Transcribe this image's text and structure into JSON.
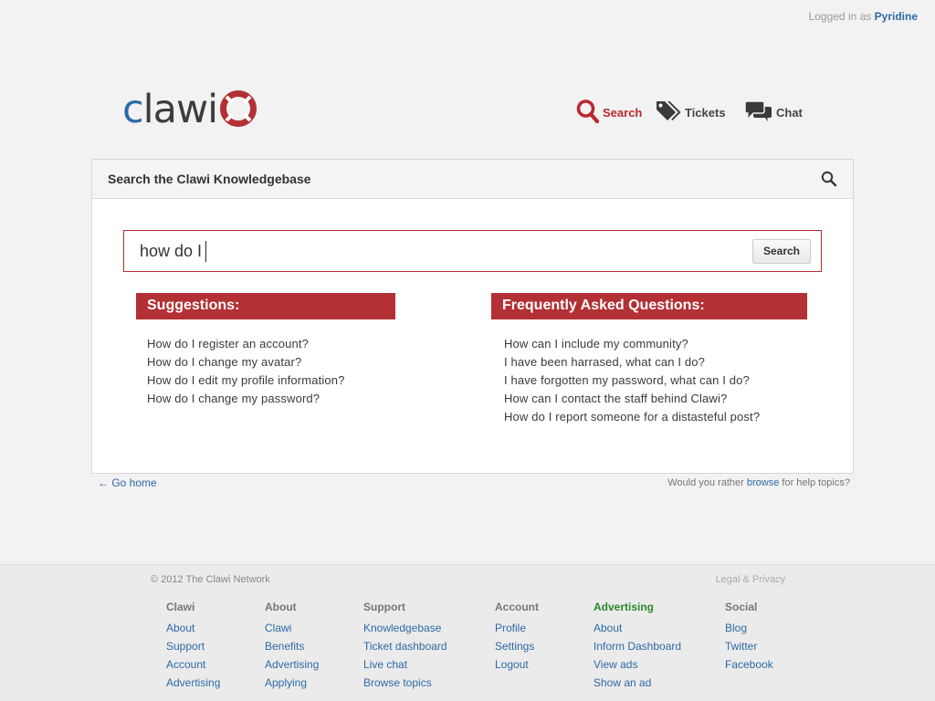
{
  "topbar": {
    "prefix": "Logged in as",
    "username": "Pyridine"
  },
  "logo": {
    "c": "c",
    "rest": "lawi"
  },
  "nav": {
    "search": "Search",
    "tickets": "Tickets",
    "chat": "Chat"
  },
  "panel": {
    "title": "Search the Clawi Knowledgebase"
  },
  "search": {
    "value": "how do I",
    "button": "Search"
  },
  "suggestions": {
    "heading": "Suggestions:",
    "items": [
      "How do I register an account?",
      "How do I change my avatar?",
      "How do I edit my profile information?",
      "How do I change my password?"
    ]
  },
  "faq": {
    "heading": "Frequently Asked Questions:",
    "items": [
      "How can I include my community?",
      "I have been harrased, what can I do?",
      "I have forgotten my password, what can I do?",
      "How can I contact the staff behind Clawi?",
      "How do I report someone for a distasteful post?"
    ]
  },
  "below": {
    "go_home": "← Go home",
    "browse_prefix": "Would you rather",
    "browse_link": "browse",
    "browse_suffix": "for help topics?"
  },
  "footer": {
    "copyright": "© 2012 The Clawi Network",
    "legal": "Legal & Privacy",
    "columns": [
      {
        "title": "Clawi",
        "links": [
          "About",
          "Support",
          "Account",
          "Advertising"
        ]
      },
      {
        "title": "About",
        "links": [
          "Clawi",
          "Benefits",
          "Advertising",
          "Applying"
        ]
      },
      {
        "title": "Support",
        "links": [
          "Knowledgebase",
          "Ticket dashboard",
          "Live chat",
          "Browse topics"
        ]
      },
      {
        "title": "Account",
        "links": [
          "Profile",
          "Settings",
          "Logout"
        ]
      },
      {
        "title": "Advertising",
        "links": [
          "About",
          "Inform Dashboard",
          "View ads",
          "Show an ad"
        ]
      },
      {
        "title": "Social",
        "links": [
          "Blog",
          "Twitter",
          "Facebook"
        ]
      }
    ]
  },
  "colors": {
    "accent": "#b33035",
    "link": "#2e6aa6",
    "green": "#2b8a2b"
  }
}
